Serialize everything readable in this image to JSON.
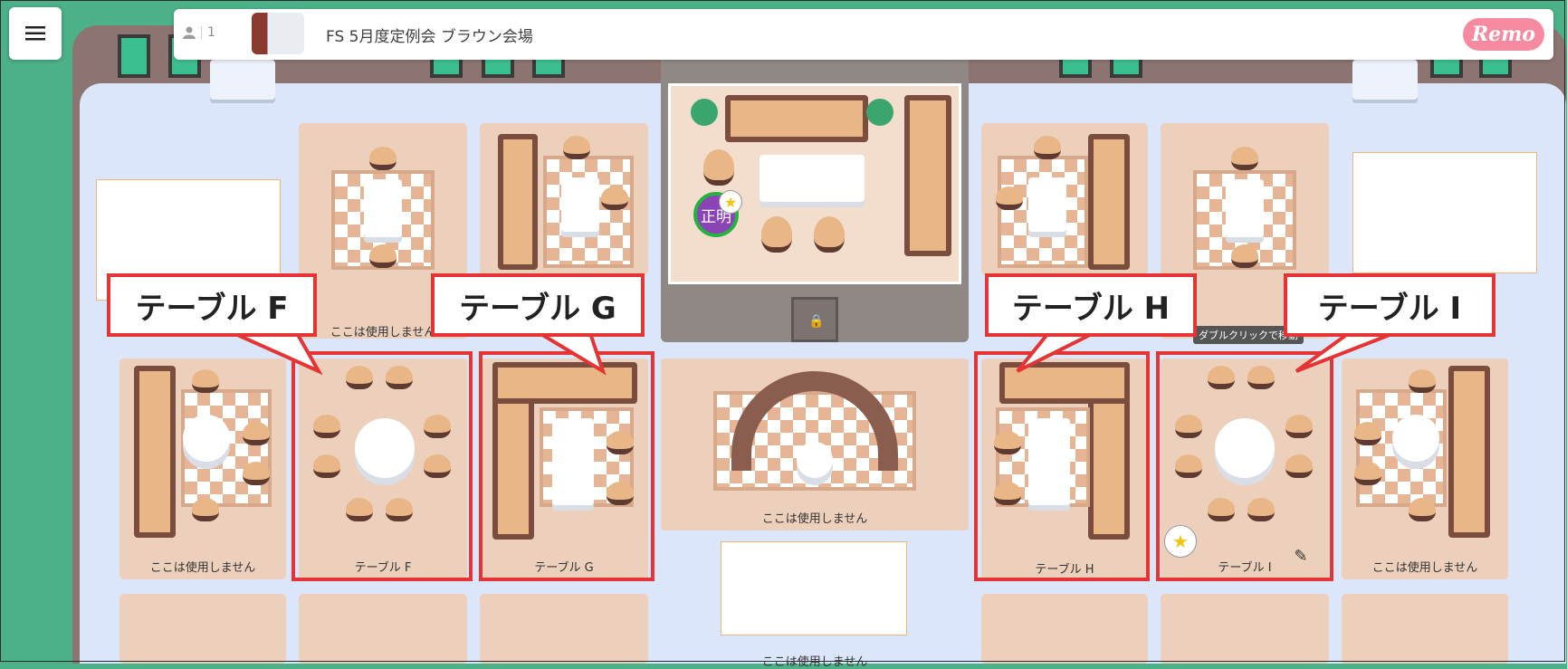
{
  "header": {
    "participant_count": "1",
    "event_title": "FS 5月度定例会 ブラウン会場",
    "brand": "Remo"
  },
  "menu": {
    "icon": "hamburger-menu-icon"
  },
  "floor": {
    "unused_label": "ここは使用しません",
    "tooltip": "ダブルクリックで移動",
    "avatar_name": "正明",
    "tables": {
      "f": "テーブル F",
      "g": "テーブル G",
      "h": "テーブル H",
      "i": "テーブル I"
    }
  },
  "callouts": {
    "f": "テーブル F",
    "g": "テーブル G",
    "h": "テーブル H",
    "i": "テーブル I"
  },
  "colors": {
    "background": "#4cb088",
    "floor": "#dbe6fb",
    "zone": "#ecd0bc",
    "callout_border": "#e53434",
    "brand": "#f58aa0",
    "avatar": "#8a44b5"
  }
}
